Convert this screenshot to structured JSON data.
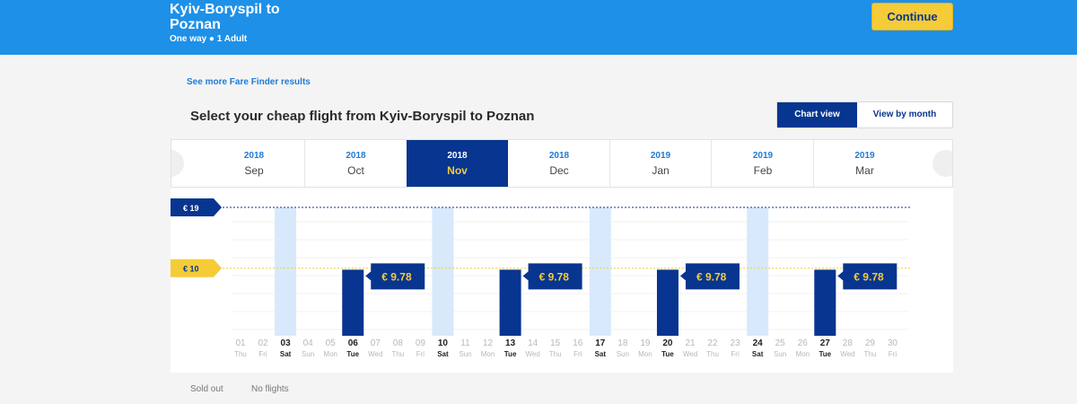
{
  "header": {
    "route_title": "Kyiv-Boryspil to Poznan",
    "trip_type": "One way",
    "passengers": "1 Adult",
    "continue_label": "Continue"
  },
  "fare_finder_link": "See more Fare Finder results",
  "select_title": "Select your cheap flight from Kyiv-Boryspil to Poznan",
  "view_toggle": {
    "chart_label": "Chart view",
    "month_label": "View by month",
    "active": "chart"
  },
  "months": [
    {
      "year": "2018",
      "month": "Sep",
      "active": false
    },
    {
      "year": "2018",
      "month": "Oct",
      "active": false
    },
    {
      "year": "2018",
      "month": "Nov",
      "active": true
    },
    {
      "year": "2018",
      "month": "Dec",
      "active": false
    },
    {
      "year": "2019",
      "month": "Jan",
      "active": false
    },
    {
      "year": "2019",
      "month": "Feb",
      "active": false
    },
    {
      "year": "2019",
      "month": "Mar",
      "active": false
    }
  ],
  "legend": {
    "sold_out": "Sold out",
    "no_flights": "No flights"
  },
  "colors": {
    "brand_blue": "#073590",
    "header_blue": "#1e90e8",
    "accent_yellow": "#f5cc37",
    "sold_out_fill": "#d7e9fb",
    "link_blue": "#1e7bd6"
  },
  "chart_data": {
    "type": "bar",
    "currency": "€",
    "ylim": [
      0,
      19
    ],
    "reference_lines": [
      {
        "label": "€ 19",
        "value": 19,
        "style": "max"
      },
      {
        "label": "€ 10",
        "value": 10,
        "style": "avg"
      }
    ],
    "days": [
      {
        "d": "01",
        "w": "Thu",
        "status": "none"
      },
      {
        "d": "02",
        "w": "Fri",
        "status": "none"
      },
      {
        "d": "03",
        "w": "Sat",
        "status": "soldout"
      },
      {
        "d": "04",
        "w": "Sun",
        "status": "none"
      },
      {
        "d": "05",
        "w": "Mon",
        "status": "none"
      },
      {
        "d": "06",
        "w": "Tue",
        "status": "fare",
        "price": 9.78,
        "label": "€ 9.78"
      },
      {
        "d": "07",
        "w": "Wed",
        "status": "none"
      },
      {
        "d": "08",
        "w": "Thu",
        "status": "none"
      },
      {
        "d": "09",
        "w": "Fri",
        "status": "none"
      },
      {
        "d": "10",
        "w": "Sat",
        "status": "soldout"
      },
      {
        "d": "11",
        "w": "Sun",
        "status": "none"
      },
      {
        "d": "12",
        "w": "Mon",
        "status": "none"
      },
      {
        "d": "13",
        "w": "Tue",
        "status": "fare",
        "price": 9.78,
        "label": "€ 9.78"
      },
      {
        "d": "14",
        "w": "Wed",
        "status": "none"
      },
      {
        "d": "15",
        "w": "Thu",
        "status": "none"
      },
      {
        "d": "16",
        "w": "Fri",
        "status": "none"
      },
      {
        "d": "17",
        "w": "Sat",
        "status": "soldout"
      },
      {
        "d": "18",
        "w": "Sun",
        "status": "none"
      },
      {
        "d": "19",
        "w": "Mon",
        "status": "none"
      },
      {
        "d": "20",
        "w": "Tue",
        "status": "fare",
        "price": 9.78,
        "label": "€ 9.78"
      },
      {
        "d": "21",
        "w": "Wed",
        "status": "none"
      },
      {
        "d": "22",
        "w": "Thu",
        "status": "none"
      },
      {
        "d": "23",
        "w": "Fri",
        "status": "none"
      },
      {
        "d": "24",
        "w": "Sat",
        "status": "soldout"
      },
      {
        "d": "25",
        "w": "Sun",
        "status": "none"
      },
      {
        "d": "26",
        "w": "Mon",
        "status": "none"
      },
      {
        "d": "27",
        "w": "Tue",
        "status": "fare",
        "price": 9.78,
        "label": "€ 9.78"
      },
      {
        "d": "28",
        "w": "Wed",
        "status": "none"
      },
      {
        "d": "29",
        "w": "Thu",
        "status": "none"
      },
      {
        "d": "30",
        "w": "Fri",
        "status": "none"
      }
    ]
  }
}
